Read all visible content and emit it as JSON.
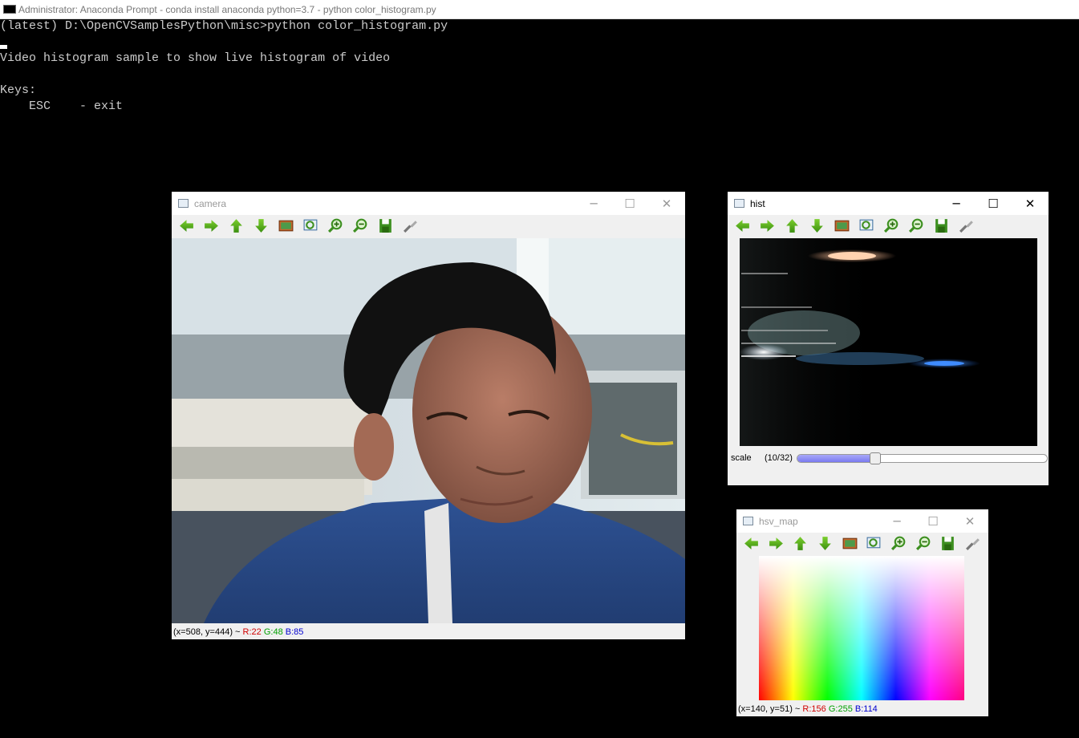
{
  "console": {
    "title": "Administrator: Anaconda Prompt - conda  install anaconda python=3.7 - python  color_histogram.py",
    "lines": [
      "(latest) D:\\OpenCVSamplesPython\\misc>python color_histogram.py",
      "",
      "Video histogram sample to show live histogram of video",
      "",
      "Keys:",
      "    ESC    - exit"
    ]
  },
  "camera_window": {
    "title": "camera",
    "status": {
      "coords": "(x=508, y=444) ~ ",
      "r": "R:22",
      "g": "G:48",
      "b": "B:85"
    }
  },
  "hist_window": {
    "title": "hist",
    "trackbar": {
      "label": "scale",
      "value_text": "(10/32)",
      "value": 10,
      "max": 32
    }
  },
  "hsv_window": {
    "title": "hsv_map",
    "status": {
      "coords": "(x=140, y=51) ~ ",
      "r": "R:156",
      "g": "G:255",
      "b": "B:114"
    }
  },
  "toolbar": {
    "buttons": [
      "pan-left-icon",
      "pan-right-icon",
      "pan-up-icon",
      "pan-down-icon",
      "zoom-fit-icon",
      "zoom-region-icon",
      "zoom-in-icon",
      "zoom-out-icon",
      "save-icon",
      "properties-icon"
    ]
  },
  "window_controls": {
    "minimize": "─",
    "maximize": "☐",
    "close": "✕"
  }
}
